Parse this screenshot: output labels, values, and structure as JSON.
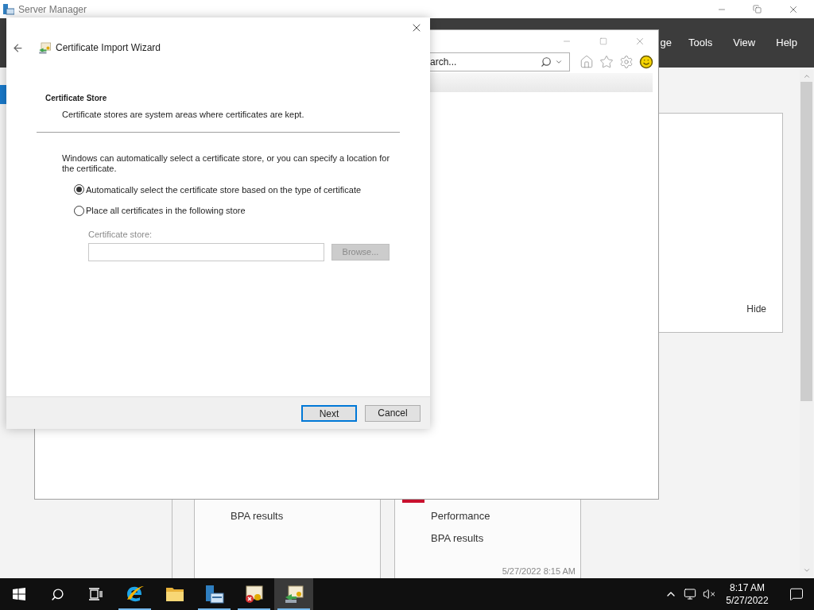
{
  "server_manager": {
    "title": "Server Manager",
    "menu": [
      "ge",
      "Tools",
      "View",
      "Help"
    ],
    "hide_link": "Hide",
    "tiles": [
      {
        "alert": false,
        "items": [
          "BPA results"
        ]
      },
      {
        "alert": true,
        "items": [
          "Performance",
          "BPA results"
        ],
        "timestamp": "5/27/2022 8:15 AM"
      }
    ]
  },
  "browser": {
    "search_placeholder": "arch..."
  },
  "wizard": {
    "title": "Certificate Import Wizard",
    "heading": "Certificate Store",
    "subtitle": "Certificate stores are system areas where certificates are kept.",
    "intro": "Windows can automatically select a certificate store, or you can specify a location for the certificate.",
    "options": [
      {
        "label": "Automatically select the certificate store based on the type of certificate",
        "selected": true
      },
      {
        "label": "Place all certificates in the following store",
        "selected": false
      }
    ],
    "store_field": {
      "label": "Certificate store:",
      "disabled": true
    },
    "browse_button": {
      "label": "Browse...",
      "disabled": true
    },
    "buttons": [
      {
        "label": "Next",
        "default": true
      },
      {
        "label": "Cancel",
        "default": false
      }
    ]
  },
  "taskbar": {
    "apps": [
      {
        "kind": "browser",
        "running": true,
        "selected": false
      },
      {
        "kind": "folder",
        "running": false,
        "selected": false
      },
      {
        "kind": "server",
        "running": true,
        "selected": false
      },
      {
        "kind": "certificate",
        "running": true,
        "selected": false
      },
      {
        "kind": "wizard",
        "running": true,
        "selected": true
      }
    ],
    "clock": {
      "time": "8:17 AM",
      "date": "5/27/2022"
    }
  }
}
